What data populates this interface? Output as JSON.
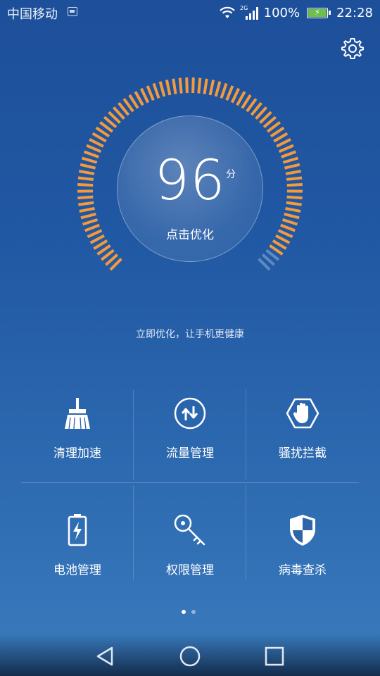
{
  "status": {
    "carrier": "中国移动",
    "network": "2G",
    "battery_pct": "100%",
    "time": "22:28"
  },
  "score": {
    "value": "96",
    "unit": "分",
    "action": "点击优化"
  },
  "tip": "立即优化，让手机更健康",
  "grid": {
    "items": [
      {
        "label": "清理加速",
        "icon": "broom-icon"
      },
      {
        "label": "流量管理",
        "icon": "data-transfer-icon"
      },
      {
        "label": "骚扰拦截",
        "icon": "hand-block-icon"
      },
      {
        "label": "电池管理",
        "icon": "battery-icon"
      },
      {
        "label": "权限管理",
        "icon": "key-icon"
      },
      {
        "label": "病毒查杀",
        "icon": "shield-icon"
      }
    ]
  },
  "pager": {
    "total": 2,
    "active": 1
  },
  "colors": {
    "background_top": "#1d4f9a",
    "background_bottom": "#3a7bbd",
    "dial_active": "#f39a3c",
    "dial_inactive": "#8fb3dd",
    "battery_fill": "#6cc04a"
  }
}
